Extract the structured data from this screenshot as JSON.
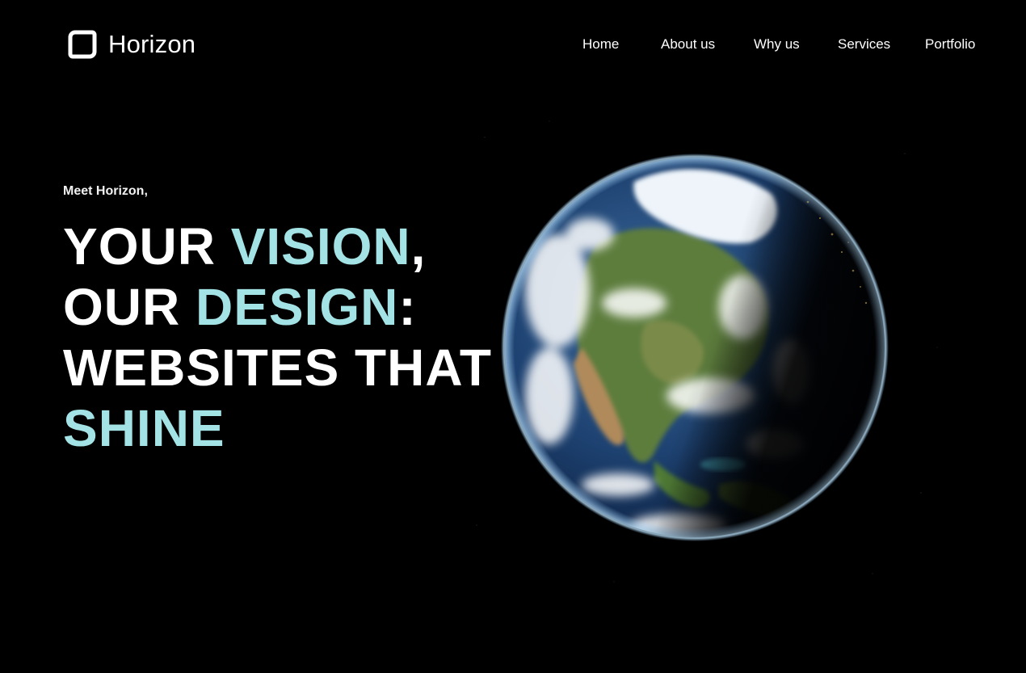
{
  "brand": {
    "name": "Horizon",
    "logo_icon": "rounded-square-icon"
  },
  "nav": {
    "items": [
      {
        "label": "Home"
      },
      {
        "label": "About us"
      },
      {
        "label": "Why us"
      },
      {
        "label": "Services"
      },
      {
        "label": "Portfolio"
      }
    ]
  },
  "hero": {
    "eyebrow": "Meet Horizon,",
    "headline": {
      "line1": {
        "pre": "YOUR ",
        "accent": "VISION",
        "post": ","
      },
      "line2": {
        "pre": "OUR ",
        "accent": "DESIGN",
        "post": ":"
      },
      "line3": {
        "text": "WEBSITES THAT"
      },
      "line4": {
        "accent": "SHINE"
      }
    },
    "image": "earth-globe-image"
  },
  "colors": {
    "background": "#000000",
    "text": "#ffffff",
    "accent": "#a3e3e6"
  }
}
